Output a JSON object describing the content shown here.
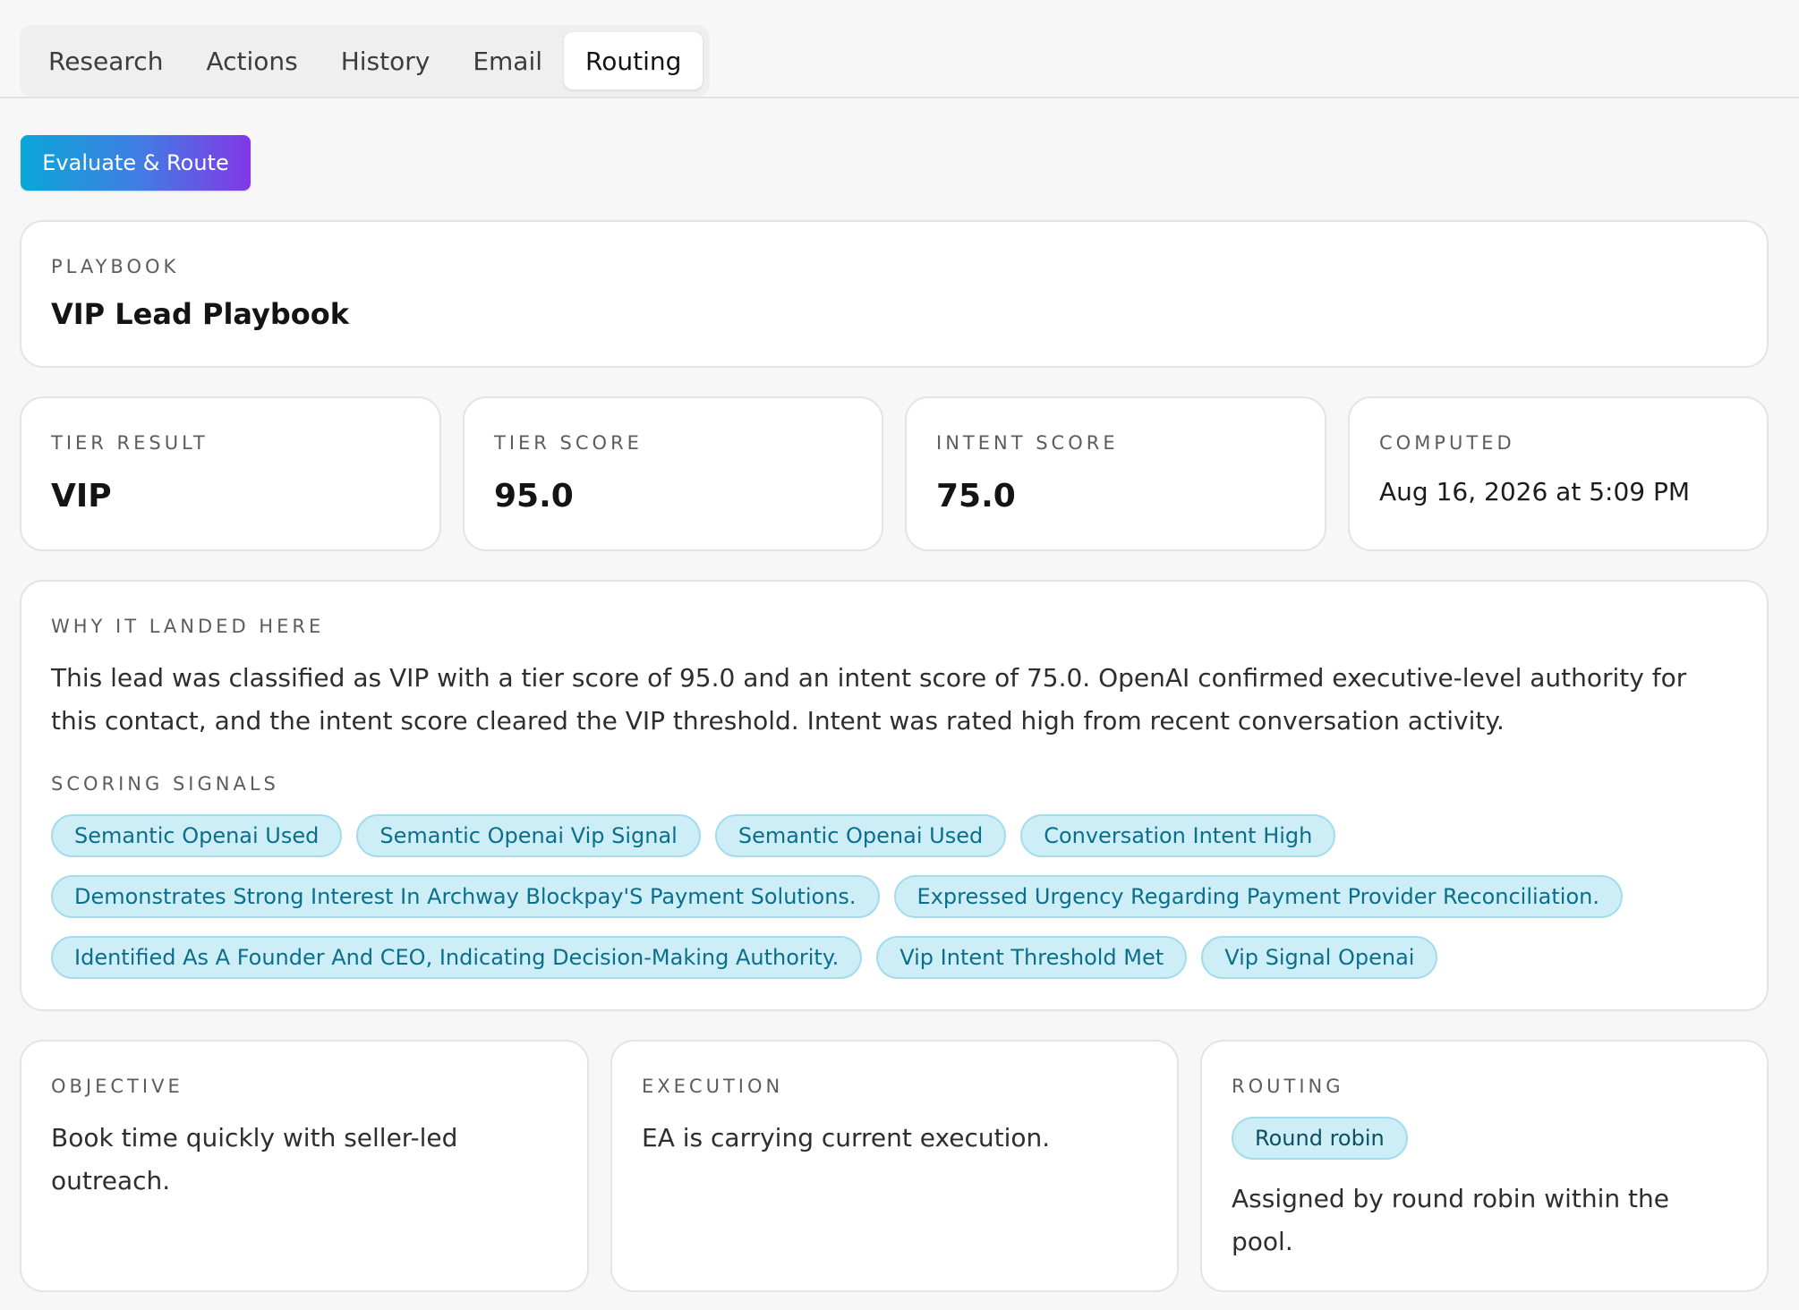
{
  "tabs": [
    {
      "label": "Research"
    },
    {
      "label": "Actions"
    },
    {
      "label": "History"
    },
    {
      "label": "Email"
    },
    {
      "label": "Routing",
      "active": true
    }
  ],
  "actions": {
    "evaluate_label": "Evaluate & Route"
  },
  "playbook": {
    "label": "PLAYBOOK",
    "name": "VIP Lead Playbook"
  },
  "metrics": {
    "tier_result": {
      "label": "TIER RESULT",
      "value": "VIP"
    },
    "tier_score": {
      "label": "TIER SCORE",
      "value": "95.0"
    },
    "intent_score": {
      "label": "INTENT SCORE",
      "value": "75.0"
    },
    "computed": {
      "label": "COMPUTED",
      "value": "Aug 16, 2026 at 5:09 PM"
    }
  },
  "why": {
    "label": "WHY IT LANDED HERE",
    "text": "This lead was classified as VIP with a tier score of 95.0 and an intent score of 75.0. OpenAI confirmed executive-level authority for this contact, and the intent score cleared the VIP threshold. Intent was rated high from recent conversation activity.",
    "signals_label": "SCORING SIGNALS",
    "signals": [
      "Semantic Openai Used",
      "Semantic Openai Vip Signal",
      "Semantic Openai Used",
      "Conversation Intent High",
      "Demonstrates Strong Interest In Archway Blockpay'S Payment Solutions.",
      "Expressed Urgency Regarding Payment Provider Reconciliation.",
      "Identified As A Founder And CEO, Indicating Decision-Making Authority.",
      "Vip Intent Threshold Met",
      "Vip Signal Openai"
    ]
  },
  "objective": {
    "label": "OBJECTIVE",
    "text": "Book time quickly with seller-led outreach."
  },
  "execution": {
    "label": "EXECUTION",
    "text": "EA is carrying current execution."
  },
  "routing": {
    "label": "ROUTING",
    "badge": "Round robin",
    "text": "Assigned by round robin within the pool."
  },
  "colors": {
    "accent_start": "#0aa6d8",
    "accent_end": "#8138e6",
    "chip_bg": "#cdeef7",
    "chip_text": "#0b6f8c"
  }
}
